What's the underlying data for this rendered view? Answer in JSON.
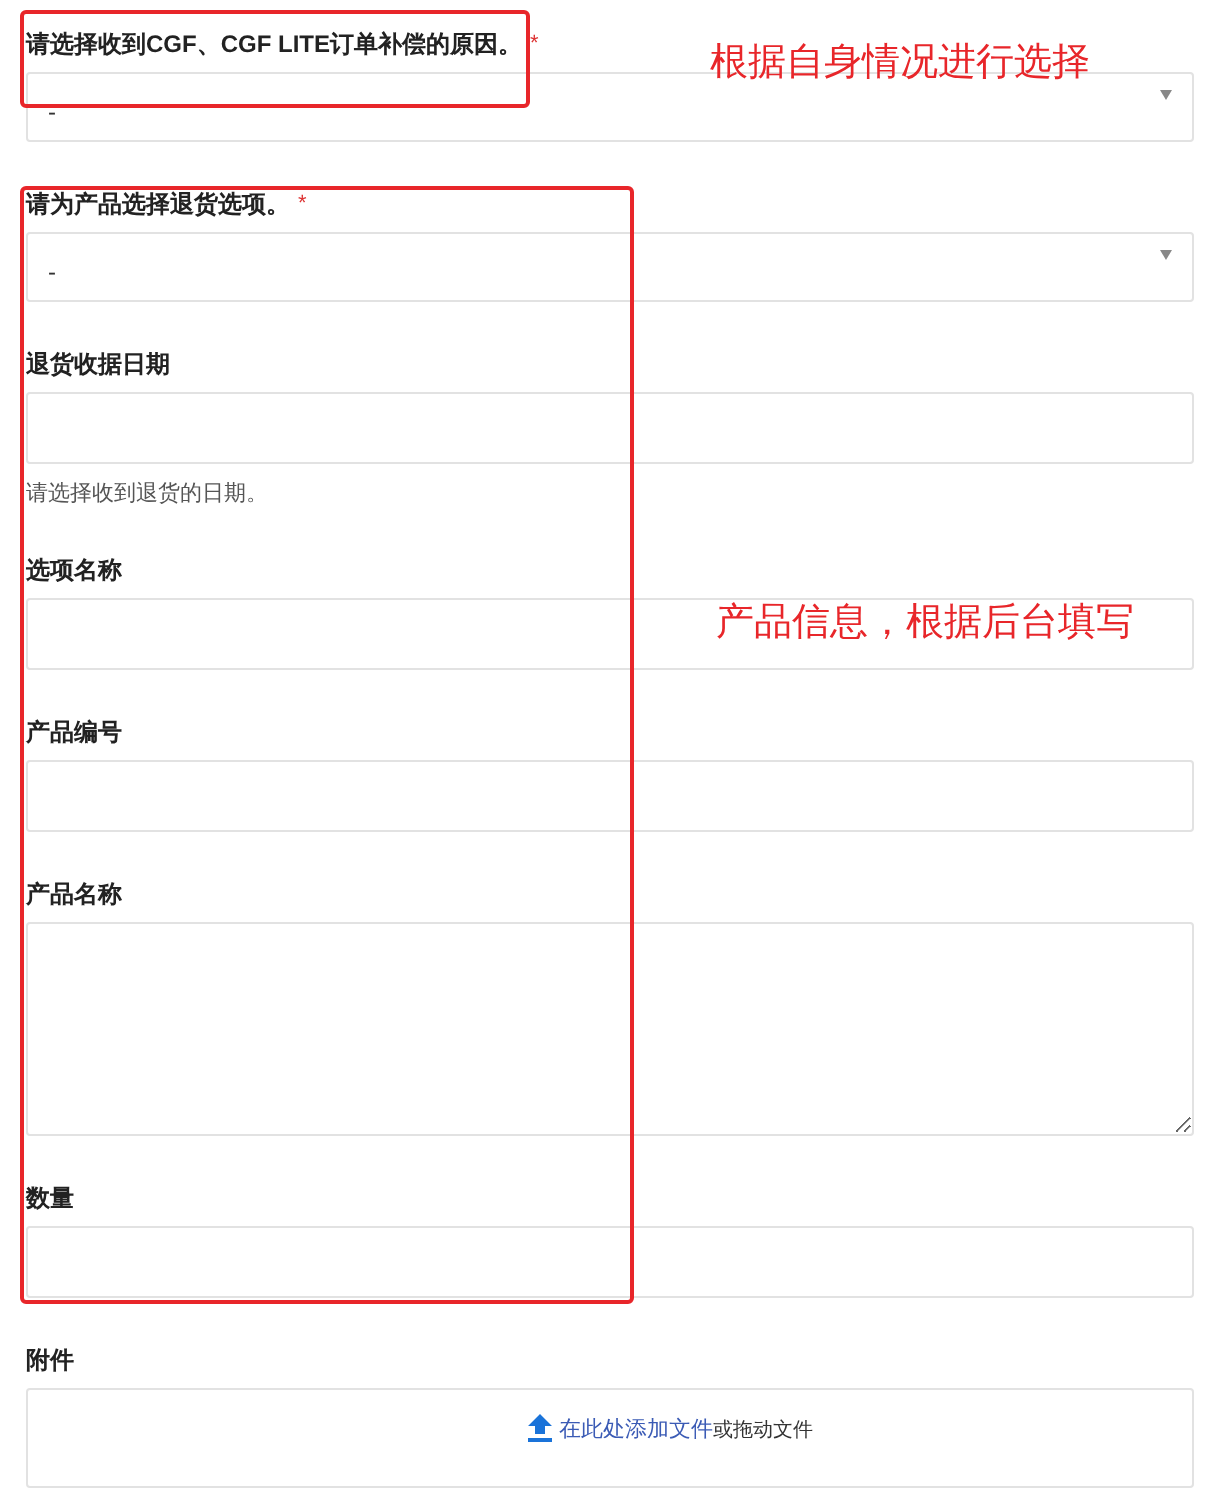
{
  "fields": [
    {
      "kind": "select",
      "label": "请选择收到CGF、CGF LITE订单补偿的原因。",
      "marker": "*",
      "value": "-"
    },
    {
      "kind": "select",
      "label": "请为产品选择退货选项。",
      "marker": "*",
      "value": "-"
    },
    {
      "kind": "text",
      "label": "退货收据日期",
      "hint": "请选择收到退货的日期。"
    },
    {
      "kind": "text",
      "label": "选项名称"
    },
    {
      "kind": "text",
      "label": "产品编号"
    },
    {
      "kind": "textarea",
      "label": "产品名称"
    },
    {
      "kind": "text",
      "label": "数量"
    },
    {
      "kind": "upload",
      "label": "附件",
      "link": "在此处添加文件",
      "suffix": "或拖动文件"
    }
  ],
  "annotations": [
    "根据自身情况进行选择",
    "产品信息，根据后台填写"
  ]
}
